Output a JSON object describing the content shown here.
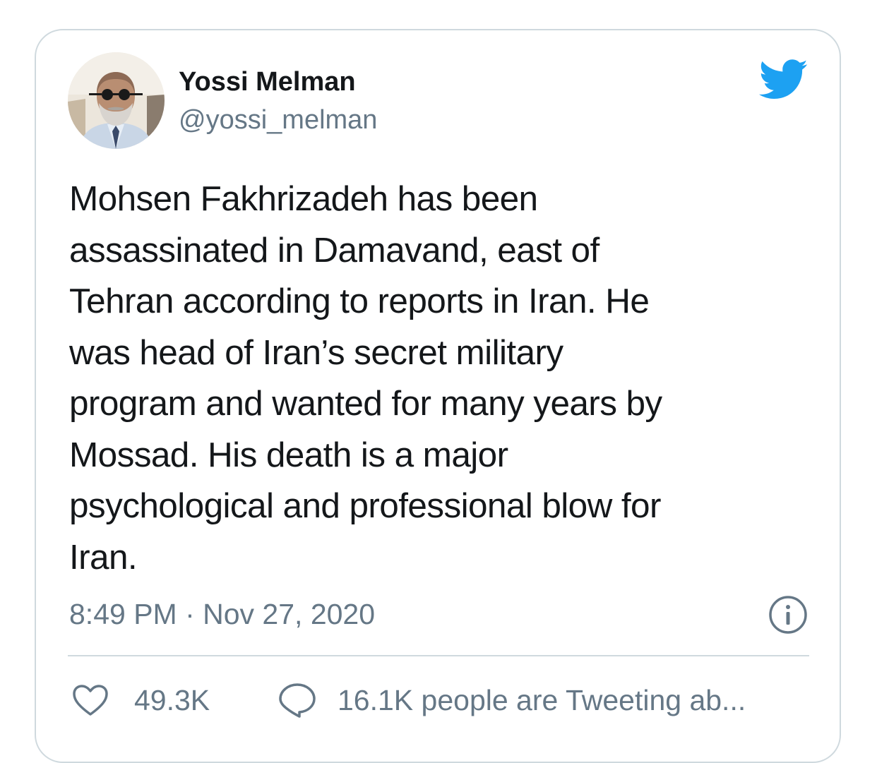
{
  "tweet": {
    "author_name": "Yossi Melman",
    "author_handle": "@yossi_melman",
    "text_lines": [
      "Mohsen Fakhrizadeh has been",
      "assassinated in Damavand, east of",
      "Tehran according to reports in Iran. He",
      "was head of Iran’s secret military",
      "program and wanted for many years by",
      "Mossad. His death is a major",
      "psychological and professional blow for",
      "Iran."
    ],
    "timestamp": "8:49 PM · Nov 27, 2020",
    "like_count": "49.3K",
    "discussion_label": "16.1K people are Tweeting ab..."
  },
  "icons": {
    "brand": "twitter-bird-icon",
    "info": "info-icon",
    "like": "heart-icon",
    "reply": "speech-bubble-icon"
  },
  "colors": {
    "brand_blue": "#1da1f2",
    "text_primary": "#14171a",
    "text_secondary": "#657786",
    "border": "#cfd9de"
  }
}
